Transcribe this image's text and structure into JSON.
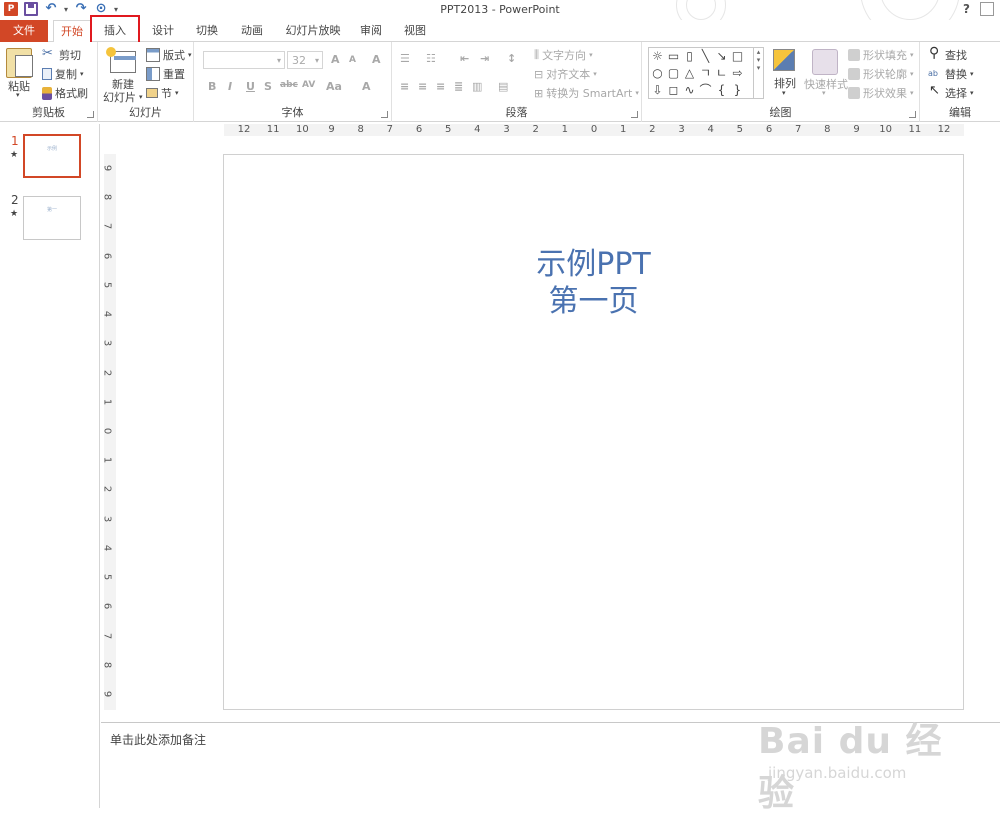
{
  "window": {
    "title": "PPT2013 - PowerPoint",
    "help": "?"
  },
  "qat": {
    "logo": "P",
    "undo": "↶",
    "redo": "↷",
    "present": "⊙",
    "more": "▾"
  },
  "tabs": [
    {
      "label": "文件",
      "key": "file"
    },
    {
      "label": "开始",
      "key": "home"
    },
    {
      "label": "插入",
      "key": "insert"
    },
    {
      "label": "设计",
      "key": "design"
    },
    {
      "label": "切换",
      "key": "transitions"
    },
    {
      "label": "动画",
      "key": "animations"
    },
    {
      "label": "幻灯片放映",
      "key": "slideshow"
    },
    {
      "label": "审阅",
      "key": "review"
    },
    {
      "label": "视图",
      "key": "view"
    }
  ],
  "ribbon": {
    "clipboard": {
      "label": "剪贴板",
      "paste": "粘贴",
      "cut": "剪切",
      "copy": "复制",
      "format_painter": "格式刷"
    },
    "slides": {
      "label": "幻灯片",
      "new_slide_1": "新建",
      "new_slide_2": "幻灯片",
      "layout": "版式",
      "reset": "重置",
      "section": "节"
    },
    "font": {
      "label": "字体",
      "font_name": "",
      "font_size": "32",
      "bold": "B",
      "italic": "I",
      "underline": "U",
      "shadow": "S",
      "strike": "abc",
      "spacing": "AV",
      "case": "Aa",
      "color": "A",
      "grow": "A",
      "shrink": "A",
      "clear": "A"
    },
    "paragraph": {
      "label": "段落",
      "text_direction": "文字方向",
      "align_text": "对齐文本",
      "smartart": "转换为 SmartArt"
    },
    "drawing": {
      "label": "绘图",
      "arrange": "排列",
      "quick_styles": "快速样式",
      "shape_fill": "形状填充",
      "shape_outline": "形状轮廓",
      "shape_effects": "形状效果"
    },
    "editing": {
      "label": "编辑",
      "find": "查找",
      "replace": "替换",
      "select": "选择"
    }
  },
  "ruler": {
    "horizontal": [
      "12",
      "11",
      "10",
      "9",
      "8",
      "7",
      "6",
      "5",
      "4",
      "3",
      "2",
      "1",
      "0",
      "1",
      "2",
      "3",
      "4",
      "5",
      "6",
      "7",
      "8",
      "9",
      "10",
      "11",
      "12"
    ],
    "vertical": [
      "9",
      "8",
      "7",
      "6",
      "5",
      "4",
      "3",
      "2",
      "1",
      "0",
      "1",
      "2",
      "3",
      "4",
      "5",
      "6",
      "7",
      "8",
      "9"
    ]
  },
  "thumbnails": [
    {
      "number": "1",
      "star": "★",
      "title": "示例"
    },
    {
      "number": "2",
      "star": "★",
      "title": "第一"
    }
  ],
  "slide": {
    "title_line1": "示例PPT",
    "title_line2": "第一页"
  },
  "notes": {
    "placeholder": "单击此处添加备注"
  },
  "watermark": {
    "brand": "Bai du 经验",
    "url": "jingyan.baidu.com"
  }
}
